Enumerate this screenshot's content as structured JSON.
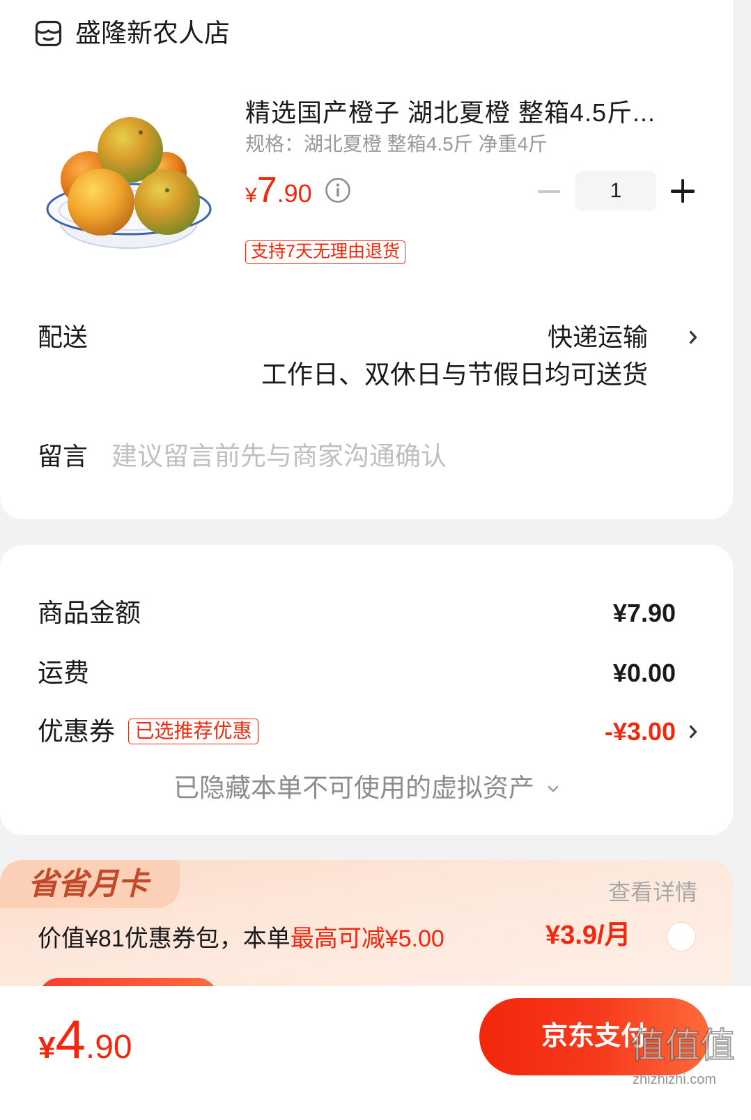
{
  "store": {
    "name": "盛隆新农人店",
    "icon": "store-icon"
  },
  "product": {
    "image_icon": "oranges-on-plate",
    "title": "精选国产橙子 湖北夏橙 整箱4.5斤...",
    "spec": "规格：湖北夏橙 整箱4.5斤 净重4斤",
    "price": {
      "currency": "¥",
      "integer": "7",
      "decimal": ".90"
    },
    "price_info_icon": "info-icon",
    "quantity": "1",
    "minus_icon": "minus-icon",
    "plus_icon": "plus-icon",
    "return_badge": "支持7天无理由退货"
  },
  "delivery": {
    "label": "配送",
    "method": "快递运输",
    "note": "工作日、双休日与节假日均可送货",
    "icon": "chevron-right-icon"
  },
  "message": {
    "label": "留言",
    "placeholder": "建议留言前先与商家沟通确认",
    "value": ""
  },
  "summary": {
    "goods": {
      "label": "商品金额",
      "value": "¥7.90"
    },
    "shipping": {
      "label": "运费",
      "value": "¥0.00"
    },
    "coupon": {
      "label": "优惠券",
      "badge": "已选推荐优惠",
      "value": "-¥3.00",
      "icon": "chevron-right-icon"
    },
    "hidden_assets": {
      "text": "已隐藏本单不可使用的虚拟资产",
      "icon": "chevron-down-icon"
    }
  },
  "monthly_card": {
    "tag": "省省月卡",
    "details_link": "查看详情",
    "desc_prefix": "价值¥81优惠券包，本单",
    "desc_highlight": "最高可减¥5.00",
    "price": "¥3.9/月",
    "selected": false
  },
  "footer": {
    "total": {
      "currency": "¥",
      "integer": "4",
      "decimal": ".90"
    },
    "pay_button": "京东支付"
  },
  "watermark": {
    "logo": "值值值",
    "site": "zhizhizhi.com"
  },
  "colors": {
    "accent": "#f2270c",
    "text": "#1a1a1a",
    "muted": "#999999",
    "placeholder": "#bfbfbf",
    "page_background": "#f2f2f2",
    "monthly_card_background": "#fde7db",
    "monthly_tag_text": "#c04a2a"
  }
}
